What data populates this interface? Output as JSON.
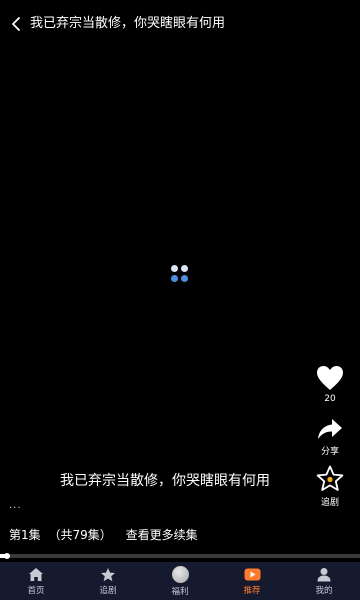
{
  "header": {
    "title": "我已弃宗当散修，你哭瞎眼有何用"
  },
  "player": {
    "subtitle": "我已弃宗当散修，你哭瞎眼有何用",
    "ellipsis": "...",
    "progress_fraction": 0.02
  },
  "actions": {
    "like_count": "20",
    "share_label": "分享",
    "follow_label": "追剧"
  },
  "episode": {
    "current": "第1集",
    "total": "（共79集）",
    "more": "查看更多续集"
  },
  "tabs": [
    {
      "label": "首页",
      "icon": "home-icon"
    },
    {
      "label": "追剧",
      "icon": "star-icon"
    },
    {
      "label": "福利",
      "icon": "welfare-coin-icon"
    },
    {
      "label": "推荐",
      "icon": "recommend-play-icon",
      "active": true
    },
    {
      "label": "我的",
      "icon": "profile-icon"
    }
  ],
  "colors": {
    "accent": "#ff7a2b",
    "tabbar_bg": "#151a2e",
    "loader_blue": "#4a90e2"
  }
}
